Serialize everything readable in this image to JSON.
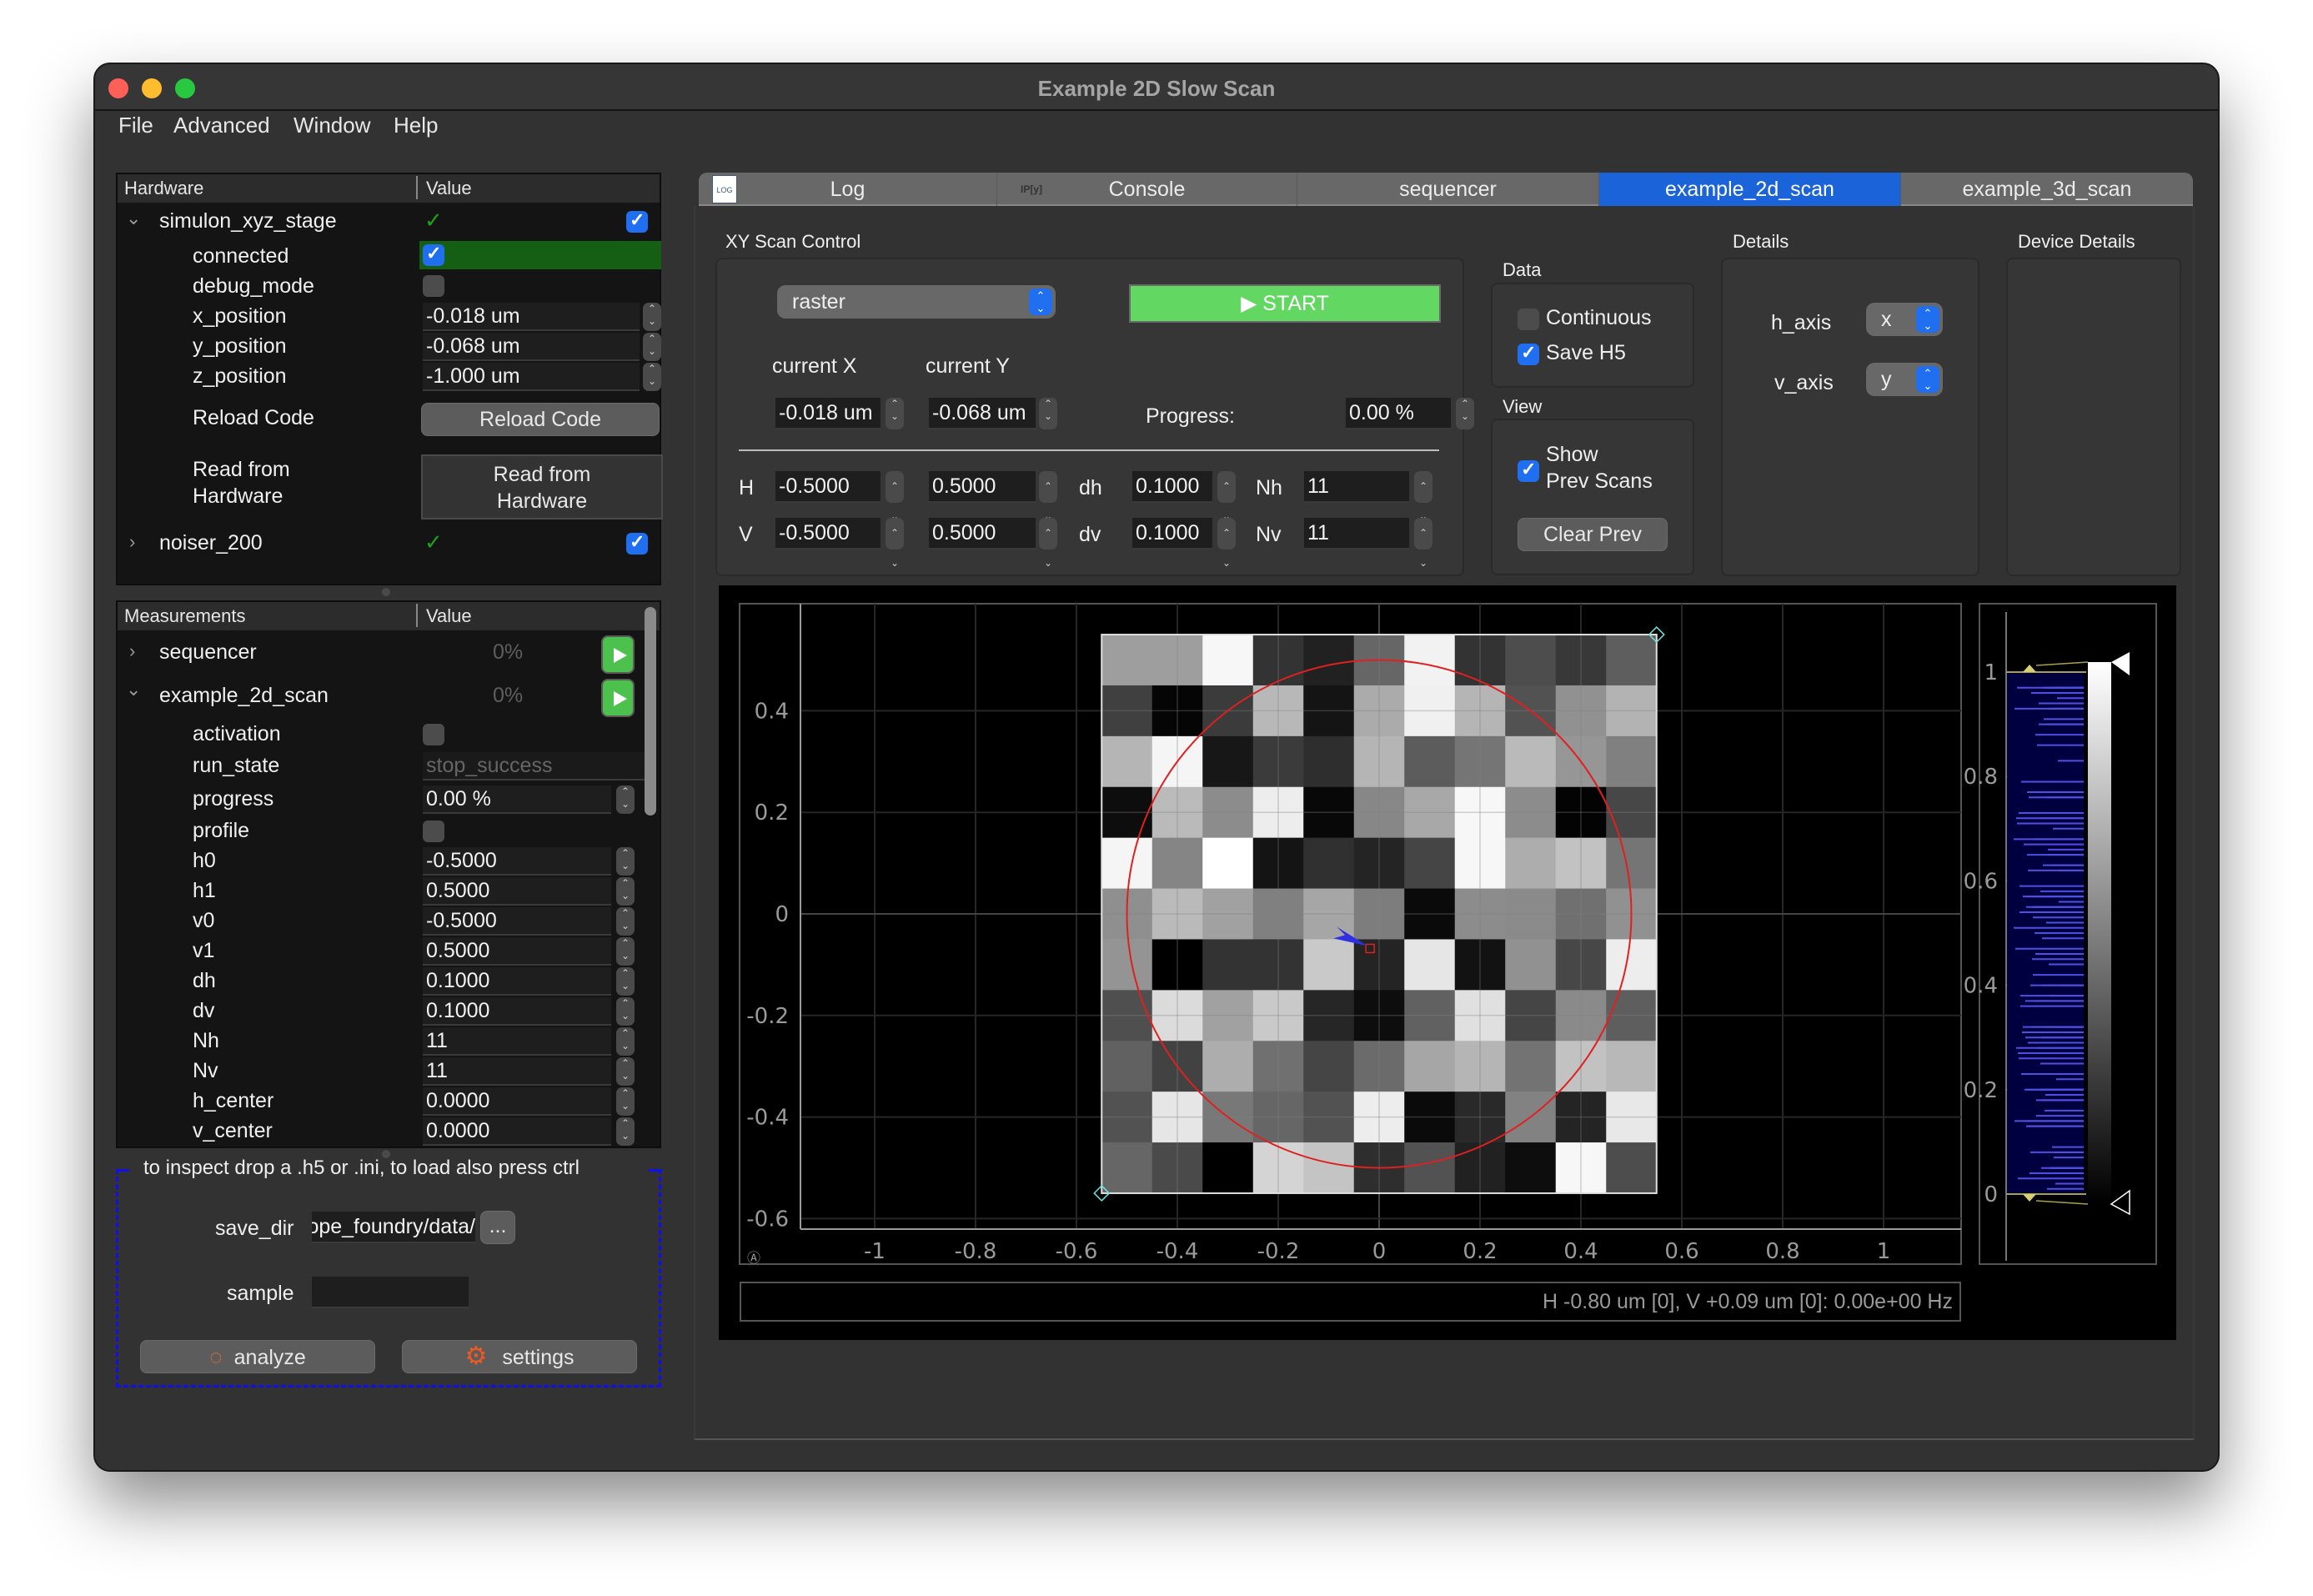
{
  "window": {
    "title": "Example 2D Slow Scan",
    "traffic_lights": [
      "#fe5f57",
      "#febc2e",
      "#28c840"
    ]
  },
  "menubar": [
    "File",
    "Advanced",
    "Window",
    "Help"
  ],
  "hardware_tree": {
    "headers": [
      "Hardware",
      "Value"
    ],
    "devices": [
      {
        "name": "simulon_xyz_stage",
        "expanded": true,
        "connected_mark": "✓",
        "enabled": true,
        "settings": [
          {
            "name": "connected",
            "type": "checkbox",
            "value": true
          },
          {
            "name": "debug_mode",
            "type": "checkbox",
            "value": false
          },
          {
            "name": "x_position",
            "type": "spin",
            "value": "-0.018 um"
          },
          {
            "name": "y_position",
            "type": "spin",
            "value": "-0.068 um"
          },
          {
            "name": "z_position",
            "type": "spin",
            "value": "-1.000 um"
          }
        ],
        "operations": [
          {
            "name": "Reload Code",
            "button": "Reload Code"
          },
          {
            "name": "Read from\nHardware",
            "button": "Read from\nHardware"
          }
        ]
      },
      {
        "name": "noiser_200",
        "expanded": false,
        "connected_mark": "✓",
        "enabled": true
      }
    ]
  },
  "measurement_tree": {
    "headers": [
      "Measurements",
      "Value"
    ],
    "measurements": [
      {
        "name": "sequencer",
        "expanded": false,
        "progress": "0%"
      },
      {
        "name": "example_2d_scan",
        "expanded": true,
        "progress": "0%"
      }
    ],
    "settings": [
      {
        "name": "activation",
        "type": "checkbox",
        "value": false
      },
      {
        "name": "run_state",
        "type": "readonly",
        "value": "stop_success"
      },
      {
        "name": "progress",
        "type": "spin",
        "value": "0.00 %"
      },
      {
        "name": "profile",
        "type": "checkbox",
        "value": false
      },
      {
        "name": "h0",
        "type": "spin",
        "value": "-0.5000"
      },
      {
        "name": "h1",
        "type": "spin",
        "value": "0.5000"
      },
      {
        "name": "v0",
        "type": "spin",
        "value": "-0.5000"
      },
      {
        "name": "v1",
        "type": "spin",
        "value": "0.5000"
      },
      {
        "name": "dh",
        "type": "spin",
        "value": "0.1000"
      },
      {
        "name": "dv",
        "type": "spin",
        "value": "0.1000"
      },
      {
        "name": "Nh",
        "type": "spin",
        "value": "11"
      },
      {
        "name": "Nv",
        "type": "spin",
        "value": "11"
      },
      {
        "name": "h_center",
        "type": "spin",
        "value": "0.0000"
      },
      {
        "name": "v_center",
        "type": "spin",
        "value": "0.0000"
      }
    ]
  },
  "data_browser": {
    "drop_hint": "to inspect drop a .h5 or .ini, to load also press ctrl",
    "save_dir_label": "save_dir",
    "save_dir_value": "/scope_foundry/data",
    "browse_label": "...",
    "sample_label": "sample",
    "sample_value": "",
    "analyze_label": "analyze",
    "settings_label": "settings"
  },
  "tabs": [
    {
      "label": "Log",
      "icon": "log-icon",
      "active": false
    },
    {
      "label": "Console",
      "icon": "ipython-icon",
      "active": false
    },
    {
      "label": "sequencer",
      "active": false
    },
    {
      "label": "example_2d_scan",
      "active": true
    },
    {
      "label": "example_3d_scan",
      "active": false
    }
  ],
  "scan_control": {
    "title": "XY Scan Control",
    "scan_type": "raster",
    "start_label": "▶ START",
    "current_x_label": "current X",
    "current_y_label": "current Y",
    "current_x": "-0.018 um",
    "current_y": "-0.068 um",
    "progress_label": "Progress:",
    "progress_value": "0.00 %",
    "rows": [
      {
        "axis": "H",
        "start": "-0.5000",
        "stop": "0.5000",
        "step_label": "dh",
        "step": "0.1000",
        "n_label": "Nh",
        "n": "11"
      },
      {
        "axis": "V",
        "start": "-0.5000",
        "stop": "0.5000",
        "step_label": "dv",
        "step": "0.1000",
        "n_label": "Nv",
        "n": "11"
      }
    ]
  },
  "data_group": {
    "title": "Data",
    "continuous_label": "Continuous",
    "continuous": false,
    "save_h5_label": "Save H5",
    "save_h5": true
  },
  "view_group": {
    "title": "View",
    "show_prev_label": "Show\nPrev Scans",
    "show_prev": true,
    "clear_prev_label": "Clear Prev"
  },
  "details": {
    "title": "Details",
    "h_axis_label": "h_axis",
    "h_axis": "x",
    "v_axis_label": "v_axis",
    "v_axis": "y"
  },
  "device_details": {
    "title": "Device Details"
  },
  "readout": "H -0.80 um [0], V +0.09 um [0]: 0.00e+00 Hz",
  "chart_data": {
    "type": "heatmap",
    "title": "",
    "xlabel": "",
    "ylabel": "",
    "xlim": [
      -1.15,
      1.15
    ],
    "ylim": [
      -0.635,
      0.56
    ],
    "xticks": [
      -1,
      -0.8,
      -0.6,
      -0.4,
      -0.2,
      0,
      0.2,
      0.4,
      0.6,
      0.8,
      1
    ],
    "xtick_labels": [
      "-1",
      "-0.8",
      "-0.6",
      "-0.4",
      "-0.2",
      "0",
      "0.2",
      "0.4",
      "0.6",
      "0.8",
      "1"
    ],
    "yticks": [
      0.4,
      0.2,
      0,
      -0.2,
      -0.4,
      -0.6
    ],
    "ytick_labels": [
      "0.4",
      "0.2",
      "0",
      "-0.2",
      "-0.4",
      "-0.6"
    ],
    "grid": true,
    "colormap": "grayscale",
    "image_extent": {
      "h": [
        -0.55,
        0.55
      ],
      "v": [
        -0.55,
        0.55
      ]
    },
    "pixel_size": 0.1,
    "values_top_to_bottom": [
      [
        0.62,
        0.62,
        0.97,
        0.2,
        0.13,
        0.4,
        0.95,
        0.2,
        0.3,
        0.22,
        0.37
      ],
      [
        0.25,
        0.02,
        0.23,
        0.72,
        0.08,
        0.67,
        0.94,
        0.71,
        0.32,
        0.57,
        0.7
      ],
      [
        0.71,
        0.96,
        0.09,
        0.23,
        0.18,
        0.71,
        0.36,
        0.46,
        0.73,
        0.59,
        0.5
      ],
      [
        0.05,
        0.73,
        0.55,
        0.93,
        0.03,
        0.53,
        0.66,
        0.97,
        0.55,
        0.01,
        0.28
      ],
      [
        0.96,
        0.52,
        1.0,
        0.08,
        0.19,
        0.14,
        0.27,
        0.97,
        0.68,
        0.76,
        0.46
      ],
      [
        0.56,
        0.73,
        0.63,
        0.5,
        0.65,
        0.49,
        0.04,
        0.55,
        0.54,
        0.44,
        0.57
      ],
      [
        0.58,
        0.0,
        0.2,
        0.2,
        0.79,
        0.14,
        0.9,
        0.07,
        0.57,
        0.28,
        0.93
      ],
      [
        0.31,
        0.86,
        0.63,
        0.79,
        0.15,
        0.05,
        0.38,
        0.88,
        0.27,
        0.54,
        0.37
      ],
      [
        0.38,
        0.26,
        0.68,
        0.44,
        0.27,
        0.42,
        0.65,
        0.71,
        0.45,
        0.76,
        0.72
      ],
      [
        0.32,
        0.9,
        0.47,
        0.4,
        0.32,
        0.93,
        0.04,
        0.16,
        0.51,
        0.14,
        0.91
      ],
      [
        0.4,
        0.29,
        0.0,
        0.83,
        0.77,
        0.18,
        0.32,
        0.13,
        0.05,
        0.97,
        0.3
      ]
    ],
    "overlays": {
      "circle": {
        "center": [
          0,
          0
        ],
        "radius": 0.5,
        "color": "#e02020"
      },
      "current_position": {
        "h": -0.018,
        "v": -0.068,
        "color": "#e02020"
      },
      "arrow_color": "#3030e0",
      "roi_handle_color": "#6fe0e0"
    },
    "histogram": {
      "levels": [
        0,
        1
      ],
      "yticks": [
        1,
        0.8,
        0.6,
        0.4,
        0.2,
        0
      ],
      "ytick_labels": [
        "1",
        "0.8",
        "0.6",
        "0.4",
        "0.2",
        "0"
      ],
      "fill_color": "#000040",
      "line_color": "#5050e0"
    }
  }
}
